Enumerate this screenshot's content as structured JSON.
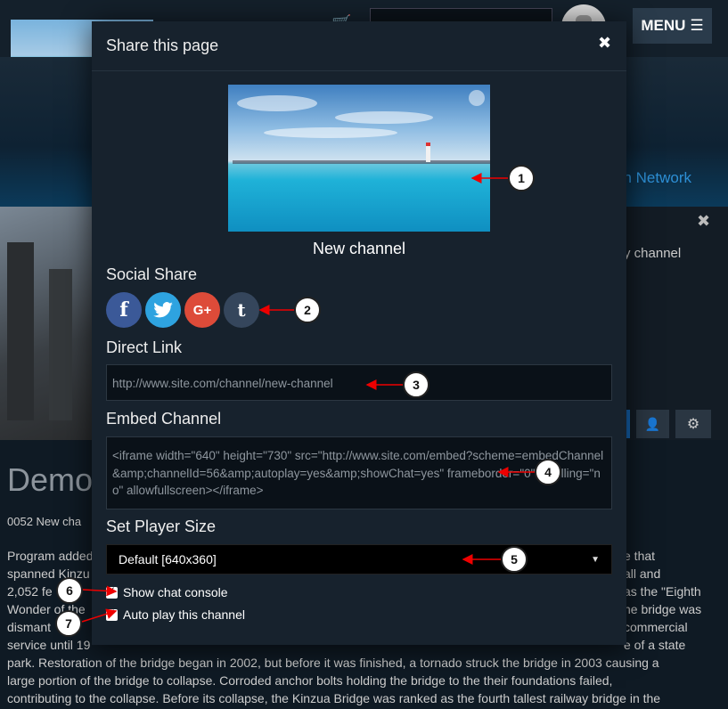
{
  "header": {
    "menu_label": "MENU"
  },
  "background": {
    "network_label": "an Network",
    "channel_text": "y channel",
    "page_title": "Demo",
    "subtitle": "0052 New cha",
    "description_lines": [
      "Program added",
      "spanned Kinzu",
      "2,052 fe",
      "Wonder of the",
      "dismant",
      "service until 19",
      "park. Restoration of the bridge began in 2002, but before it was finished, a tornado struck the bridge in 2003 causing a",
      "large portion of the bridge to collapse. Corroded anchor bolts holding the bridge to the their foundations failed,",
      "contributing to the collapse. Before its collapse, the Kinzua Bridge was ranked as the fourth tallest railway bridge in the"
    ],
    "description_right_lines": [
      "e that",
      "all and",
      "as the \"Eighth",
      "he bridge was",
      "commercial",
      "e of a state"
    ]
  },
  "modal": {
    "title": "Share this page",
    "channel_name": "New channel",
    "social_share_label": "Social Share",
    "social": [
      {
        "name": "facebook",
        "glyph": "f",
        "color": "#3b5998"
      },
      {
        "name": "twitter",
        "glyph": "twitter-bird",
        "color": "#2ea3e0"
      },
      {
        "name": "google-plus",
        "glyph": "G+",
        "color": "#dd4b39"
      },
      {
        "name": "tumblr",
        "glyph": "t",
        "color": "#35465c"
      }
    ],
    "direct_link_label": "Direct Link",
    "direct_link_value": "http://www.site.com/channel/new-channel",
    "embed_label": "Embed Channel",
    "embed_value": "<iframe width=\"640\" height=\"730\" src=\"http://www.site.com/embed?scheme=embedChannel&amp;channelId=56&amp;autoplay=yes&amp;showChat=yes\" frameborder=\"0\" scrolling=\"no\" allowfullscreen></iframe>",
    "player_size_label": "Set Player Size",
    "player_size_value": "Default [640x360]",
    "show_chat_label": "Show chat console",
    "autoplay_label": "Auto play this channel"
  },
  "callouts": [
    "1",
    "2",
    "3",
    "4",
    "5",
    "6",
    "7"
  ]
}
